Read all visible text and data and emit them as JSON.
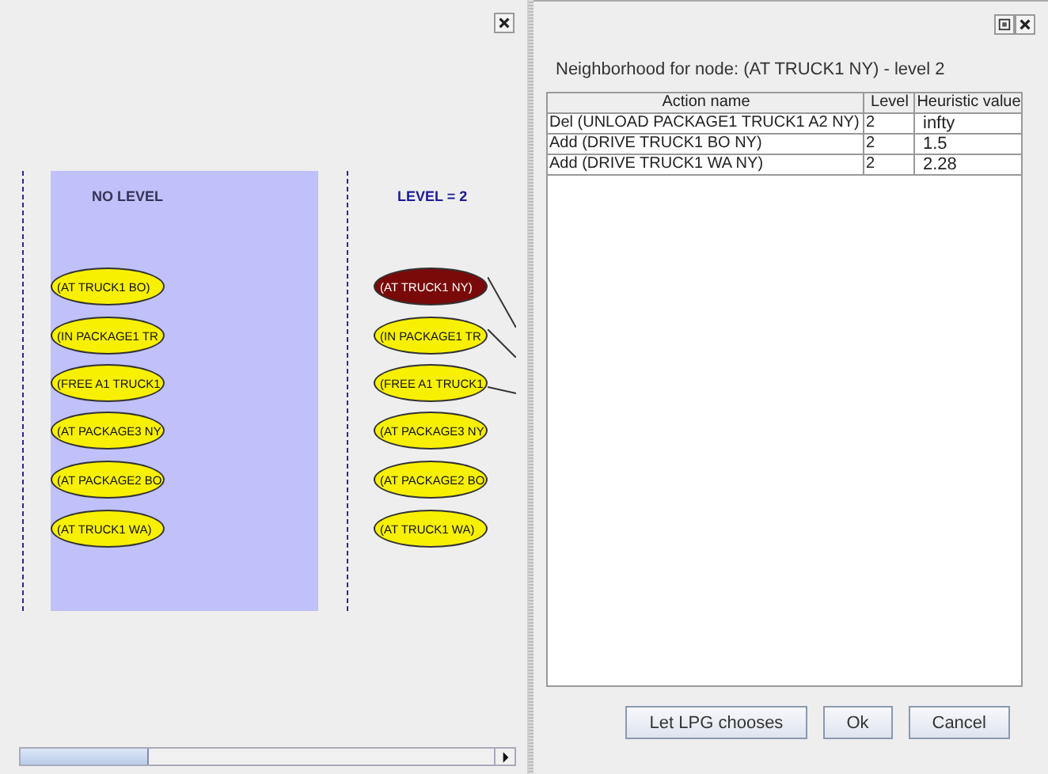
{
  "graph": {
    "columns": [
      {
        "title": "NO LEVEL",
        "kind": "unleveled",
        "nodes": [
          {
            "label": "(AT TRUCK1 BO)",
            "selected": false,
            "linked": false
          },
          {
            "label": "(IN PACKAGE1 TR",
            "selected": false,
            "linked": false
          },
          {
            "label": "(FREE A1 TRUCK1",
            "selected": false,
            "linked": false
          },
          {
            "label": "(AT PACKAGE3 NY",
            "selected": false,
            "linked": false
          },
          {
            "label": "(AT PACKAGE2 BO",
            "selected": false,
            "linked": false
          },
          {
            "label": "(AT TRUCK1 WA)",
            "selected": false,
            "linked": false
          }
        ]
      },
      {
        "title": "LEVEL = 2",
        "kind": "leveled",
        "nodes": [
          {
            "label": "(AT TRUCK1 NY)",
            "selected": true,
            "linked": true
          },
          {
            "label": "(IN PACKAGE1 TR",
            "selected": false,
            "linked": true
          },
          {
            "label": "(FREE A1 TRUCK1",
            "selected": false,
            "linked": true
          },
          {
            "label": "(AT PACKAGE3 NY",
            "selected": false,
            "linked": false
          },
          {
            "label": "(AT PACKAGE2 BO",
            "selected": false,
            "linked": false
          },
          {
            "label": "(AT TRUCK1 WA)",
            "selected": false,
            "linked": false
          }
        ]
      }
    ]
  },
  "dialog": {
    "caption": "Neighborhood for node: (AT TRUCK1 NY) - level 2",
    "table": {
      "columns": [
        "Action name",
        "Level",
        "Heuristic value"
      ],
      "rows": [
        [
          "Del (UNLOAD PACKAGE1 TRUCK1 A2 NY)",
          "2",
          "infty"
        ],
        [
          "Add (DRIVE TRUCK1 BO NY)",
          "2",
          "1.5"
        ],
        [
          "Add (DRIVE TRUCK1 WA NY)",
          "2",
          "2.28"
        ]
      ]
    },
    "buttons": [
      "Let LPG chooses",
      "Ok",
      "Cancel"
    ]
  }
}
